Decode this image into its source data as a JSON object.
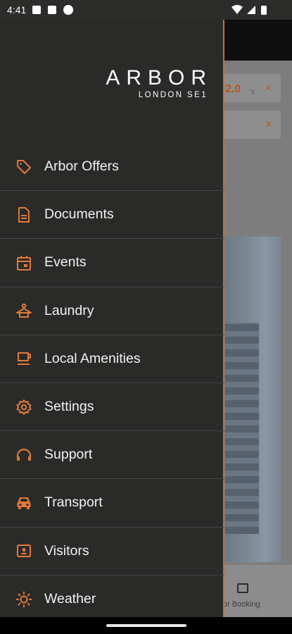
{
  "status_bar": {
    "time": "4:41",
    "left_icons": [
      "square-icon",
      "square-icon",
      "circle-icon"
    ],
    "right_icons": [
      "wifi-icon",
      "signal-icon",
      "battery-icon"
    ]
  },
  "background": {
    "weather_temp": "2.0",
    "weather_unit": "°c",
    "close_symbol": "×",
    "visitor_booking_label": "tor Booking"
  },
  "drawer": {
    "brand": {
      "name": "ARBOR",
      "subtitle": "LONDON SE1"
    },
    "accent_color": "#e07a3a",
    "items": [
      {
        "label": "Arbor Offers",
        "icon": "tag-icon"
      },
      {
        "label": "Documents",
        "icon": "document-icon"
      },
      {
        "label": "Events",
        "icon": "calendar-icon"
      },
      {
        "label": "Laundry",
        "icon": "hanger-icon"
      },
      {
        "label": "Local Amenities",
        "icon": "coffee-icon"
      },
      {
        "label": "Settings",
        "icon": "gear-icon"
      },
      {
        "label": "Support",
        "icon": "headset-icon"
      },
      {
        "label": "Transport",
        "icon": "car-icon"
      },
      {
        "label": "Visitors",
        "icon": "contact-card-icon"
      },
      {
        "label": "Weather",
        "icon": "sun-icon"
      }
    ]
  }
}
